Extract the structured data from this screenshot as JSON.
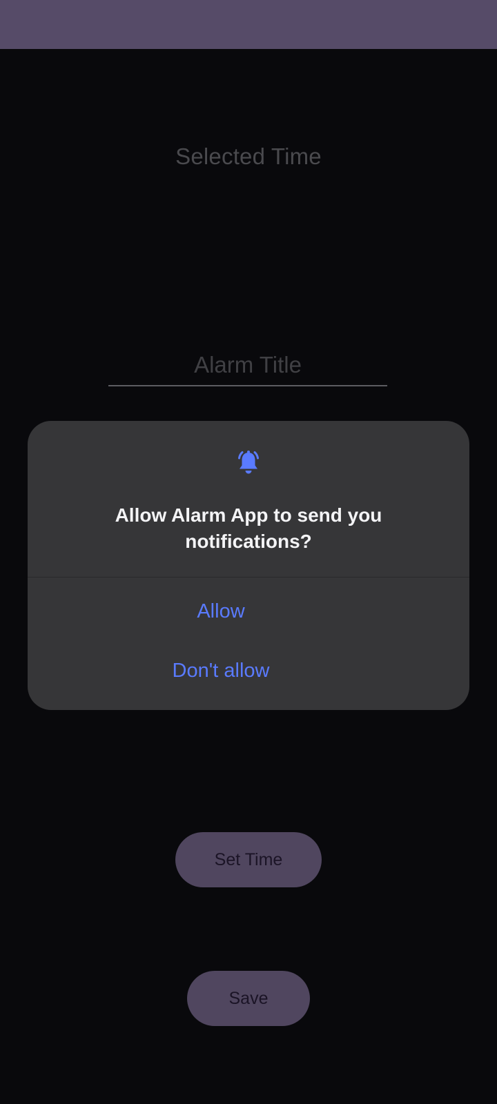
{
  "main": {
    "selected_time_label": "Selected Time",
    "title_field": {
      "placeholder": "Alarm Title",
      "value": ""
    },
    "set_time_label": "Set Time",
    "save_label": "Save"
  },
  "dialog": {
    "icon": "bell-ringing-icon",
    "message": "Allow Alarm App to send you notifications?",
    "allow_label": "Allow",
    "deny_label": "Don't allow"
  },
  "colors": {
    "app_bar": "#564b68",
    "background": "#09090c",
    "dialog_background": "#363638",
    "dialog_accent": "#5a7bff",
    "button_fill": "#50465f"
  }
}
